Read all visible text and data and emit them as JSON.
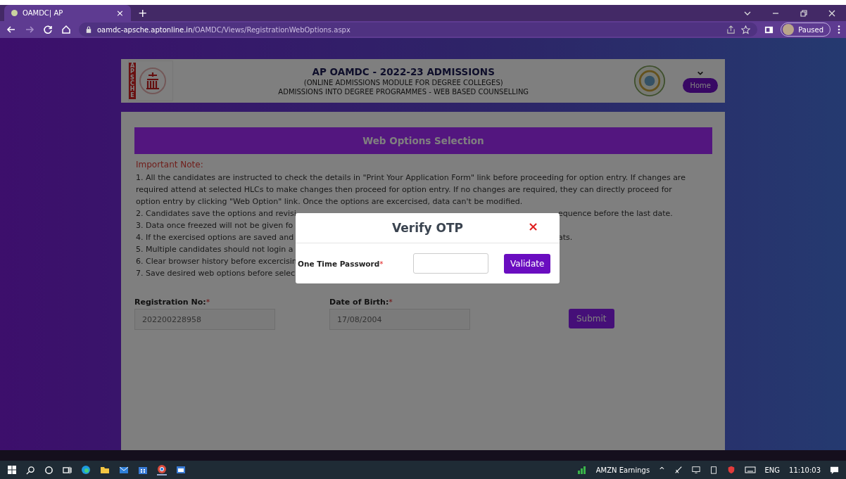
{
  "browser": {
    "tab_title": "OAMDC| AP",
    "tab_close": "×",
    "new_tab": "+",
    "address_host": "oamdc-apsche.aptonline.in",
    "address_path": "/OAMDC/Views/RegistrationWebOptions.aspx",
    "profile": "Paused"
  },
  "header": {
    "logo_letters": "APSCHE",
    "title": "AP OAMDC - 2022-23 ADMISSIONS",
    "subtitle": "(ONLINE ADMISSIONS MODULE FOR DEGREE COLLEGES)",
    "tagline": "ADMISSIONS INTO DEGREE PROGRAMMES - WEB BASED COUNSELLING",
    "home": "Home"
  },
  "section_title": "Web Options Selection",
  "note_heading": "Important Note:",
  "first_note": "1. All the candidates are instructed to check the details in \"Print Your Application Form\" link before proceeding for option entry. If changes are required attend at selected HLCs to make changes then proceed for option entry. If no changes are required, they can directly proceed for option entry by clicking \"Web Option\" link. Once the options are excercised, data can't be modified.",
  "notes": [
    {
      "left": "2. Candidates save the options and revisi",
      "right": "equence before the last date."
    },
    {
      "left": "3. Data once freezed will not be given fo"
    },
    {
      "left": "4. If the exercised options are saved and",
      "right": "ats."
    },
    {
      "left": "5. Multiple candidates should not login a"
    },
    {
      "left": "6. Clear browser history before excercisin"
    },
    {
      "left": "7. Save desired web options before selec"
    }
  ],
  "form": {
    "fields": [
      {
        "label": "Registration No:",
        "required": "*",
        "value": "202200228958"
      },
      {
        "label": "Date of Birth:",
        "required": "*",
        "value": "17/08/2004"
      }
    ],
    "submit": "Submit"
  },
  "modal": {
    "title": "Verify OTP",
    "close": "×",
    "label": "One Time Password",
    "required": "*",
    "button": "Validate"
  },
  "taskbar": {
    "news": "AMZN Earnings",
    "tray_caret": "^",
    "language": "ENG",
    "time": "11:10:03"
  }
}
